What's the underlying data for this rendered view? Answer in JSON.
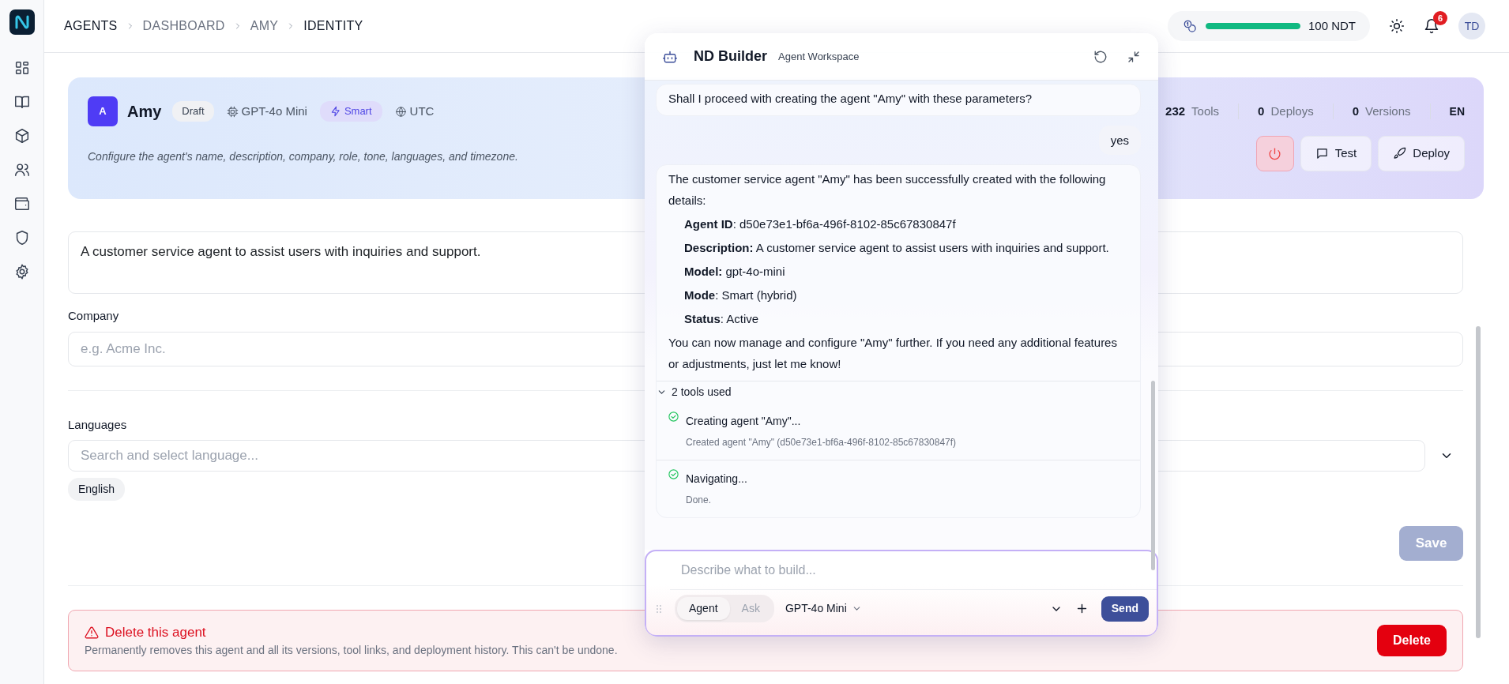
{
  "breadcrumbs": [
    {
      "label": "AGENTS",
      "kind": "section"
    },
    {
      "label": "DASHBOARD",
      "kind": "link"
    },
    {
      "label": "AMY",
      "kind": "link"
    },
    {
      "label": "IDENTITY",
      "kind": "current"
    }
  ],
  "topbar": {
    "credits": {
      "level": 1.0,
      "text": "100 NDT"
    },
    "notifications": "6",
    "avatar": "TD"
  },
  "agent": {
    "initial": "A",
    "name": "Amy",
    "tags": [
      {
        "kind": "status",
        "text": "Draft"
      },
      {
        "kind": "model",
        "text": "GPT-4o Mini"
      },
      {
        "kind": "mode",
        "text": "Smart"
      },
      {
        "kind": "timezone",
        "text": "UTC"
      }
    ],
    "description": "Configure the agent's name, description, company, role, tone, languages, and timezone.",
    "stats": [
      {
        "value": "232",
        "label": "Tools"
      },
      {
        "value": "0",
        "label": "Deploys"
      },
      {
        "value": "0",
        "label": "Versions"
      }
    ],
    "language": "EN",
    "actions": [
      {
        "kind": "power"
      },
      {
        "kind": "test",
        "label": "Test"
      },
      {
        "kind": "deploy",
        "label": "Deploy"
      }
    ]
  },
  "form": {
    "description_value": "A customer service agent to assist users with inquiries and support.",
    "company": {
      "label": "Company",
      "placeholder": "e.g. Acme Inc."
    },
    "languages": {
      "label": "Languages",
      "placeholder": "Search and select language...",
      "chips": [
        "English"
      ]
    },
    "save": {
      "label": "Save",
      "disabled": true
    }
  },
  "danger": {
    "title": "Delete this agent",
    "text": "Permanently removes this agent and all its versions, tool links, and deployment history. This can't be undone.",
    "button": "Delete"
  },
  "chat": {
    "title": "ND Builder",
    "subtitle": "Agent Workspace",
    "messages": [
      {
        "kind": "bot",
        "blocks": [
          {
            "kind": "paragraph",
            "text": "Shall I proceed with creating the agent \"Amy\" with these parameters?"
          }
        ]
      },
      {
        "kind": "user",
        "blocks": [
          {
            "kind": "paragraph",
            "text": "yes"
          }
        ]
      },
      {
        "kind": "bot",
        "blocks": [
          {
            "kind": "paragraph",
            "text": "The customer service agent \"Amy\" has been successfully created with the following details:"
          },
          {
            "kind": "detail",
            "text": "**Agent ID**: d50e73e1-bf6a-496f-8102-85c67830847f"
          },
          {
            "kind": "detail",
            "text": "**Description:** A customer service agent to assist users with inquiries and support."
          },
          {
            "kind": "detail",
            "text": "**Model:** gpt-4o-mini"
          },
          {
            "kind": "detail",
            "text": "**Mode**: Smart (hybrid)"
          },
          {
            "kind": "detail",
            "text": "**Status**: Active"
          },
          {
            "kind": "paragraph",
            "text": "You can now manage and configure \"Amy\" further. If you need any additional features or adjustments, just let me know!"
          }
        ],
        "tools": {
          "label": "2 tools used",
          "expanded": true,
          "items": [
            {
              "title": "Creating agent \"Amy\"...",
              "detail": "Created agent \"Amy\" (d50e73e1-bf6a-496f-8102-85c67830847f)",
              "done": true
            },
            {
              "title": "Navigating...",
              "detail": "Done.",
              "done": true
            }
          ]
        }
      }
    ],
    "composer": {
      "placeholder": "Describe what to build...",
      "modes": [
        {
          "label": "Agent",
          "selected": true
        },
        {
          "label": "Ask",
          "selected": false
        }
      ],
      "model": "GPT-4o Mini",
      "send": "Send"
    }
  }
}
